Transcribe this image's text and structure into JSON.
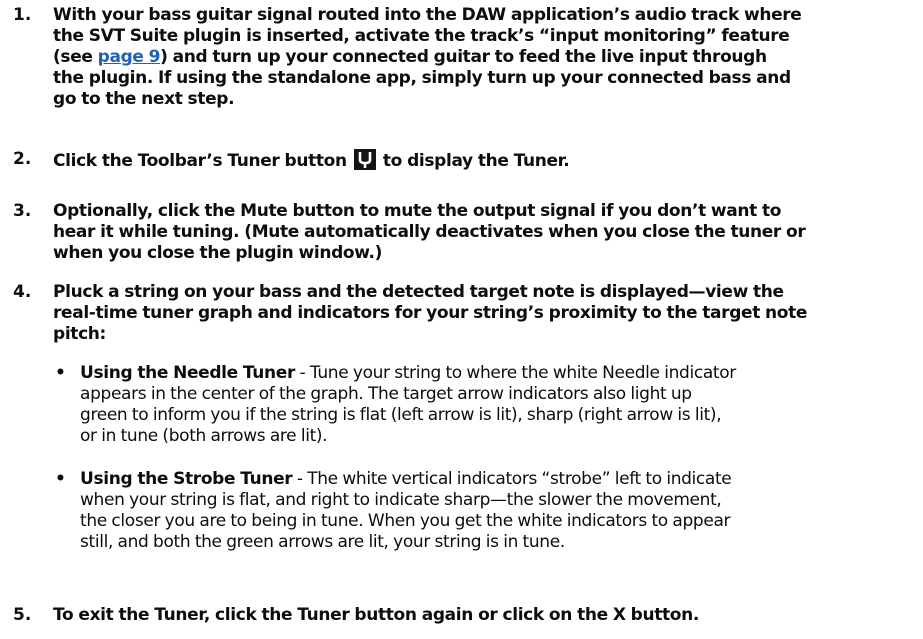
{
  "steps": [
    {
      "number": "1.",
      "lines": [
        "With your bass guitar signal routed into the DAW application’s audio track where",
        "the SVT Suite plugin is inserted, activate the track’s “input monitoring” feature",
        "(see ",
        "page 9",
        ") and turn up your connected guitar to feed the live input through",
        "the plugin. If using the standalone app, simply turn up your connected bass and",
        "go to the next step."
      ]
    },
    {
      "number": "2.",
      "before_icon": "Click the Toolbar’s Tuner button",
      "after_icon": "to display the Tuner.",
      "icon": "tuning-fork-icon"
    },
    {
      "number": "3.",
      "lines": [
        "Optionally, click the Mute button to mute the output signal if you don’t want to",
        "hear it while tuning. (Mute automatically deactivates when you close the tuner or",
        "when you close the plugin window.)"
      ]
    },
    {
      "number": "4.",
      "lines": [
        "Pluck a string on your bass and the detected target note is displayed—view the",
        "real-time tuner graph and indicators for your string’s proximity to the target note",
        "pitch:"
      ]
    },
    {
      "number": "5.",
      "lines": [
        "To exit the Tuner, click the Tuner button again or click on the X button."
      ]
    }
  ],
  "bullets": [
    {
      "marker": "•",
      "title": "Using the Needle Tuner",
      "lines": [
        " - Tune your string to where the white Needle indicator",
        "appears in the center of the graph. The target arrow indicators also light up",
        "green to inform you if the string is flat (left arrow is lit), sharp (right arrow is lit),",
        "or in tune (both arrows are lit)."
      ]
    },
    {
      "marker": "•",
      "title": "Using the Strobe Tuner",
      "lines": [
        " - The white vertical indicators “strobe” left to indicate",
        "when your string is flat, and right to indicate sharp—the slower the movement,",
        "the closer you are to being in tune. When you get the white indicators to appear",
        "still, and both the green arrows are lit, your string is in tune."
      ]
    }
  ],
  "colors": {
    "text": "#0d0d0d",
    "link": "#1f63b8",
    "icon_bg": "#141414"
  }
}
